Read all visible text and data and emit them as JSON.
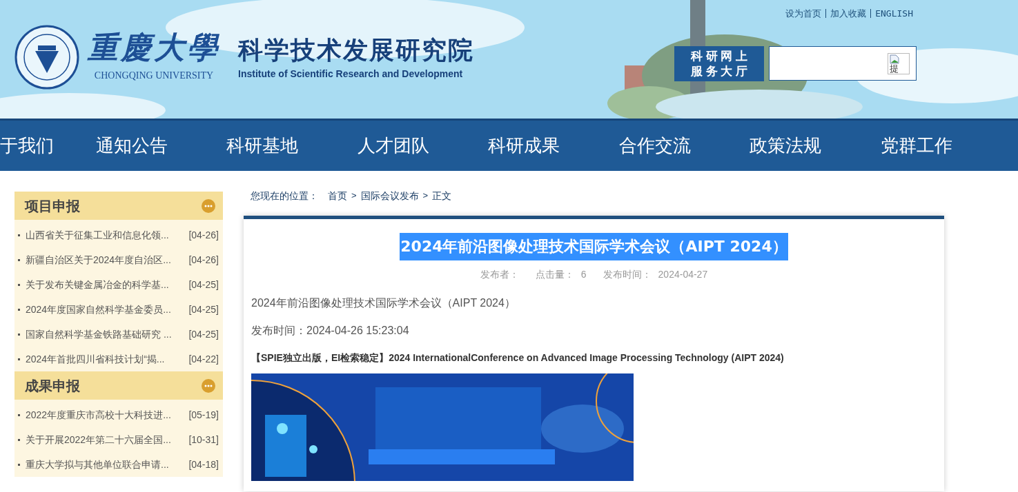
{
  "header": {
    "logo_text": "重慶大學",
    "logo_english": "CHONGQING UNIVERSITY",
    "institute_name": "科学技术发展研究院",
    "institute_english": "Institute of Scientific Research and Development",
    "top_links": [
      "设为首页",
      "加入收藏",
      "ENGLISH"
    ],
    "service_label": [
      "科 研 网 上",
      "服 务 大 厅"
    ],
    "search_button": "提"
  },
  "nav": {
    "items": [
      "于我们",
      "通知公告",
      "科研基地",
      "人才团队",
      "科研成果",
      "合作交流",
      "政策法规",
      "党群工作"
    ]
  },
  "sidebar": {
    "sections": [
      {
        "title": "项目申报",
        "items": [
          {
            "title": "山西省关于征集工业和信息化领...",
            "date": "[04-26]"
          },
          {
            "title": "新疆自治区关于2024年度自治区...",
            "date": "[04-26]"
          },
          {
            "title": "关于发布关键金属冶金的科学基...",
            "date": "[04-25]"
          },
          {
            "title": "2024年度国家自然科学基金委员...",
            "date": "[04-25]"
          },
          {
            "title": "国家自然科学基金铁路基础研究 ...",
            "date": "[04-25]"
          },
          {
            "title": "2024年首批四川省科技计划“揭...",
            "date": "[04-22]"
          }
        ]
      },
      {
        "title": "成果申报",
        "items": [
          {
            "title": "2022年度重庆市高校十大科技进...",
            "date": "[05-19]"
          },
          {
            "title": "关于开展2022年第二十六届全国...",
            "date": "[10-31]"
          },
          {
            "title": "重庆大学拟与其他单位联合申请...",
            "date": "[04-18]"
          }
        ]
      }
    ]
  },
  "breadcrumb": {
    "label": "您现在的位置：",
    "separator": ">",
    "items": [
      "首页",
      "国际会议发布",
      "正文"
    ]
  },
  "article": {
    "title": "2024年前沿图像处理技术国际学术会议（AIPT 2024）",
    "title_highlighted": true,
    "meta": [
      {
        "label": "发布者："
      },
      {
        "label": "点击量：",
        "value": "6"
      },
      {
        "label": "发布时间：",
        "value": "2024-04-27"
      }
    ],
    "body": [
      {
        "kind": "text",
        "text": "2024年前沿图像处理技术国际学术会议（AIPT 2024）"
      },
      {
        "kind": "text",
        "text": "发布时间：2024-04-26 15:23:04"
      },
      {
        "kind": "bold",
        "text": "【SPIE独立出版，EI检索稳定】2024 InternationalConference on Advanced Image Processing Technology (AIPT 2024)"
      },
      {
        "kind": "picture"
      }
    ]
  }
}
